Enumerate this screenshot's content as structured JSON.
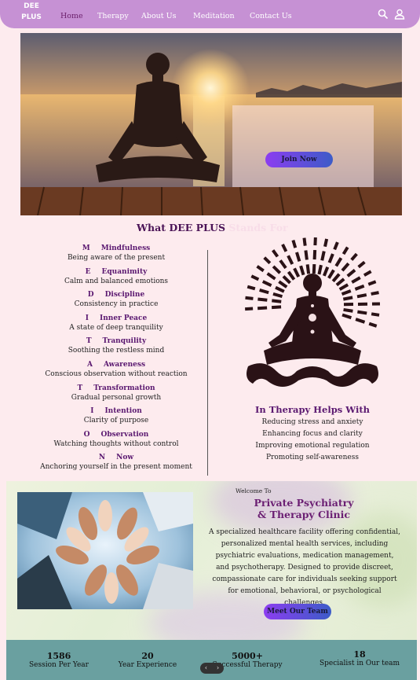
{
  "header": {
    "logo_line1": "DEE",
    "logo_line2": "PLUS",
    "nav": [
      {
        "label": "Home"
      },
      {
        "label": "Therapy"
      },
      {
        "label": "About Us"
      },
      {
        "label": "Meditation"
      },
      {
        "label": "Contact Us"
      }
    ],
    "icons": [
      "search-icon",
      "user-icon"
    ]
  },
  "hero": {
    "join_label": "Join Now"
  },
  "stands_for": {
    "title_part1": "What DEE PLUS",
    "title_part2": "Stands For",
    "items": [
      {
        "letter": "M",
        "word": "Mindfulness",
        "desc": "Being aware of the present"
      },
      {
        "letter": "E",
        "word": "Equanimity",
        "desc": "Calm and balanced emotions"
      },
      {
        "letter": "D",
        "word": "Discipline",
        "desc": "Consistency in practice"
      },
      {
        "letter": "I",
        "word": "Inner Peace",
        "desc": "A state of deep tranquility"
      },
      {
        "letter": "T",
        "word": "Tranquility",
        "desc": "Soothing the restless mind"
      },
      {
        "letter": "A",
        "word": "Awareness",
        "desc": "Conscious observation without reaction"
      },
      {
        "letter": "T",
        "word": "Transformation",
        "desc": "Gradual personal growth"
      },
      {
        "letter": "I",
        "word": "Intention",
        "desc": "Clarity of purpose"
      },
      {
        "letter": "O",
        "word": "Observation",
        "desc": "Watching thoughts without control"
      },
      {
        "letter": "N",
        "word": "Now",
        "desc": "Anchoring yourself in the present moment"
      }
    ]
  },
  "helps": {
    "title": "In Therapy Helps With",
    "items": [
      "Reducing stress and anxiety",
      "Enhancing focus and clarity",
      "Improving emotional regulation",
      "Promoting self-awareness"
    ]
  },
  "clinic": {
    "welcome": "Welcome To",
    "title_line1": "Private Psychiatry",
    "title_line2": "& Therapy Clinic",
    "desc_lines": [
      "A specialized healthcare facility offering confidential,",
      "personalized mental health services, including",
      "psychiatric evaluations, medication management,",
      "and psychotherapy. Designed to provide discreet,",
      "compassionate care for individuals seeking support",
      "for emotional, behavioral, or psychological challenges."
    ],
    "button": "Meet Our Team"
  },
  "stats": [
    {
      "num": "1586",
      "label": "Session Per Year"
    },
    {
      "num": "20",
      "label": "Year Experience"
    },
    {
      "num": "5000+",
      "label": "Successful Therapy"
    },
    {
      "num": "18",
      "label": "Specialist in Our team"
    }
  ],
  "pager": {
    "prev": "‹",
    "next": "›"
  },
  "colors": {
    "nav_bg": "#c691d4",
    "accent_purple": "#5a1870",
    "page_bg": "#fdebee",
    "stats_bg": "#6aa0a0"
  }
}
